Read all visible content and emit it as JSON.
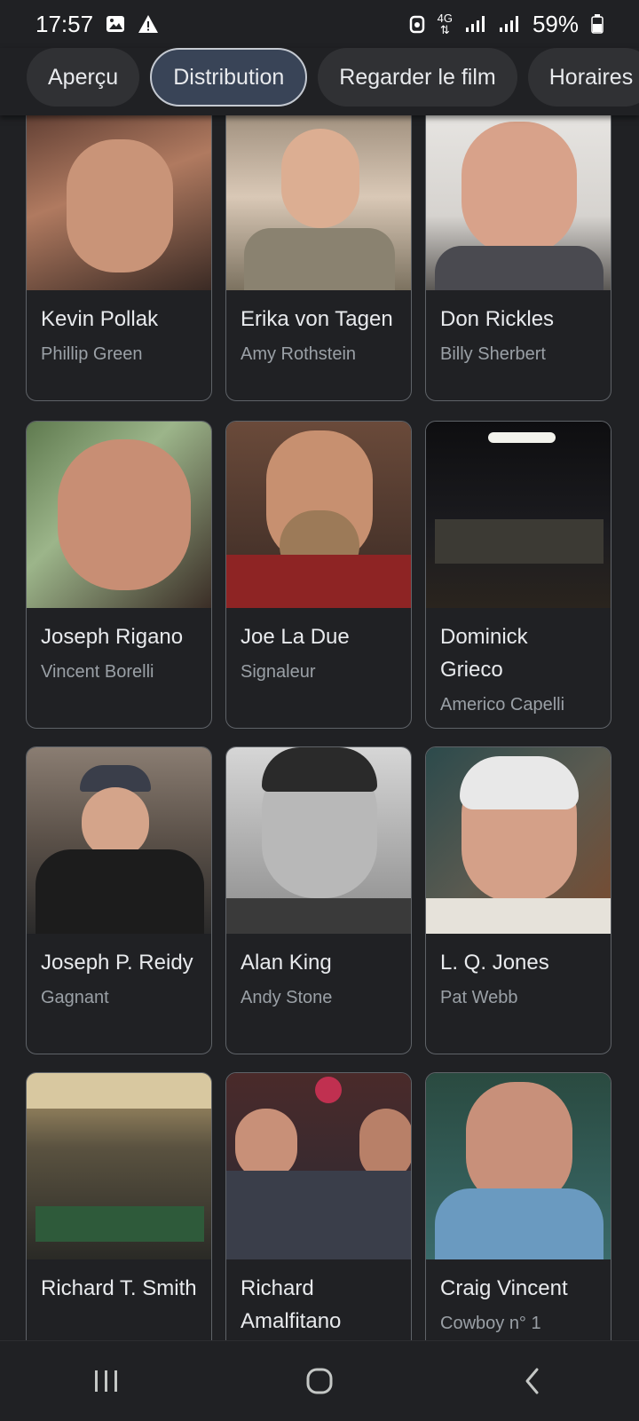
{
  "status": {
    "time": "17:57",
    "network": "4G",
    "battery": "59%"
  },
  "tabs": [
    {
      "label": "Aperçu"
    },
    {
      "label": "Distribution"
    },
    {
      "label": "Regarder le film"
    },
    {
      "label": "Horaires"
    }
  ],
  "cast": [
    {
      "name": "Kevin Pollak",
      "role": "Phillip Green"
    },
    {
      "name": "Erika von Tagen",
      "role": "Amy Rothstein"
    },
    {
      "name": "Don Rickles",
      "role": "Billy Sherbert"
    },
    {
      "name": "Joseph Rigano",
      "role": "Vincent Borelli"
    },
    {
      "name": "Joe La Due",
      "role": "Signaleur"
    },
    {
      "name": "Dominick Grieco",
      "role": "Americo Capelli"
    },
    {
      "name": "Joseph P. Reidy",
      "role": "Gagnant"
    },
    {
      "name": "Alan King",
      "role": "Andy Stone"
    },
    {
      "name": "L. Q. Jones",
      "role": "Pat Webb"
    },
    {
      "name": "Richard T. Smith",
      "role": ""
    },
    {
      "name": "Richard Amalfitano",
      "role": ""
    },
    {
      "name": "Craig Vincent",
      "role": "Cowboy n° 1"
    }
  ],
  "colors": {
    "background": "#202124",
    "chip": "#303134",
    "chip_active": "#394457",
    "card_border": "#5f6368",
    "text_primary": "#e8eaed",
    "text_secondary": "#9aa0a6"
  }
}
